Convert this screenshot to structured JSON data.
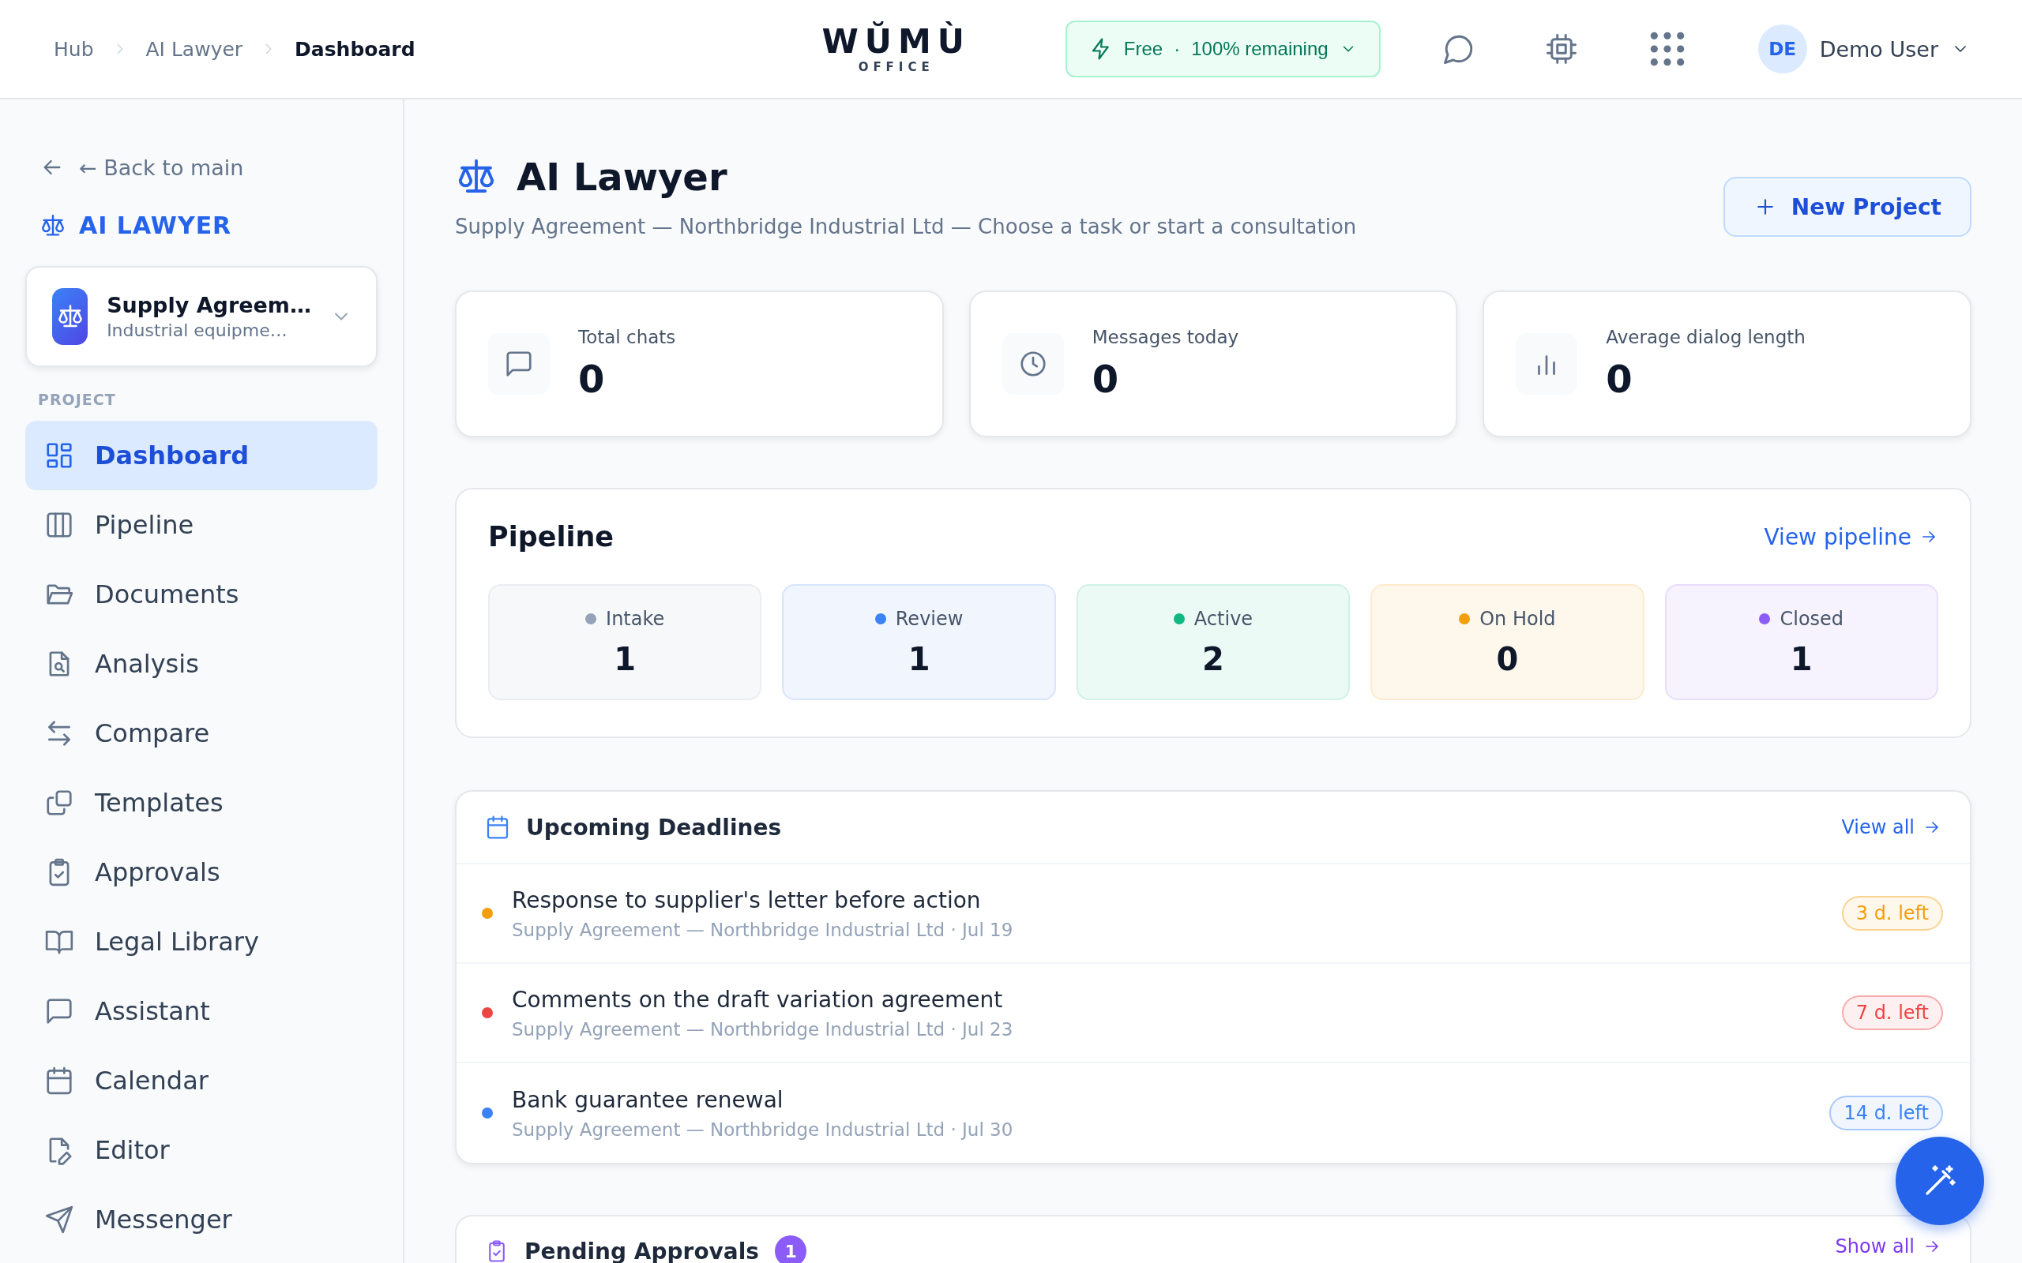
{
  "header": {
    "breadcrumbs": [
      {
        "label": "Hub",
        "current": false
      },
      {
        "label": "AI Lawyer",
        "current": false
      },
      {
        "label": "Dashboard",
        "current": true
      }
    ],
    "logo": {
      "name": "WŬMÙ",
      "sub": "OFFICE"
    },
    "plan": {
      "name": "Free",
      "separator": "·",
      "remaining": "100% remaining"
    },
    "user": {
      "initials": "DE",
      "name": "Demo User"
    }
  },
  "sidebar": {
    "back": "← Back to main",
    "app_title": "AI LAWYER",
    "project": {
      "name": "Supply Agreem…",
      "description": "Industrial equipme…"
    },
    "section": "PROJECT",
    "items": [
      {
        "label": "Dashboard",
        "selected": true
      },
      {
        "label": "Pipeline",
        "selected": false
      },
      {
        "label": "Documents",
        "selected": false
      },
      {
        "label": "Analysis",
        "selected": false
      },
      {
        "label": "Compare",
        "selected": false
      },
      {
        "label": "Templates",
        "selected": false
      },
      {
        "label": "Approvals",
        "selected": false
      },
      {
        "label": "Legal Library",
        "selected": false
      },
      {
        "label": "Assistant",
        "selected": false
      },
      {
        "label": "Calendar",
        "selected": false
      },
      {
        "label": "Editor",
        "selected": false
      },
      {
        "label": "Messenger",
        "selected": false
      }
    ]
  },
  "page": {
    "title": "AI Lawyer",
    "subtitle": "Supply Agreement — Northbridge Industrial Ltd — Choose a task or start a consultation",
    "new_button": "New Project"
  },
  "stats": [
    {
      "label": "Total chats",
      "value": "0"
    },
    {
      "label": "Messages today",
      "value": "0"
    },
    {
      "label": "Average dialog length",
      "value": "0"
    }
  ],
  "pipeline": {
    "title": "Pipeline",
    "link": "View pipeline",
    "stages": [
      {
        "label": "Intake",
        "count": "1",
        "color": "#94a3b8"
      },
      {
        "label": "Review",
        "count": "1",
        "color": "#3b82f6"
      },
      {
        "label": "Active",
        "count": "2",
        "color": "#10b981"
      },
      {
        "label": "On Hold",
        "count": "0",
        "color": "#f59e0b"
      },
      {
        "label": "Closed",
        "count": "1",
        "color": "#8b5cf6"
      }
    ]
  },
  "deadlines": {
    "title": "Upcoming Deadlines",
    "link": "View all",
    "items": [
      {
        "title": "Response to supplier's letter before action",
        "meta": "Supply Agreement — Northbridge Industrial Ltd · Jul 19",
        "badge": "3 d. left",
        "color": "#f59e0b"
      },
      {
        "title": "Comments on the draft variation agreement",
        "meta": "Supply Agreement — Northbridge Industrial Ltd · Jul 23",
        "badge": "7 d. left",
        "color": "#ef4444"
      },
      {
        "title": "Bank guarantee renewal",
        "meta": "Supply Agreement — Northbridge Industrial Ltd · Jul 30",
        "badge": "14 d. left",
        "color": "#3b82f6"
      }
    ]
  },
  "approvals": {
    "title": "Pending Approvals",
    "count": "1",
    "link": "Show all"
  }
}
